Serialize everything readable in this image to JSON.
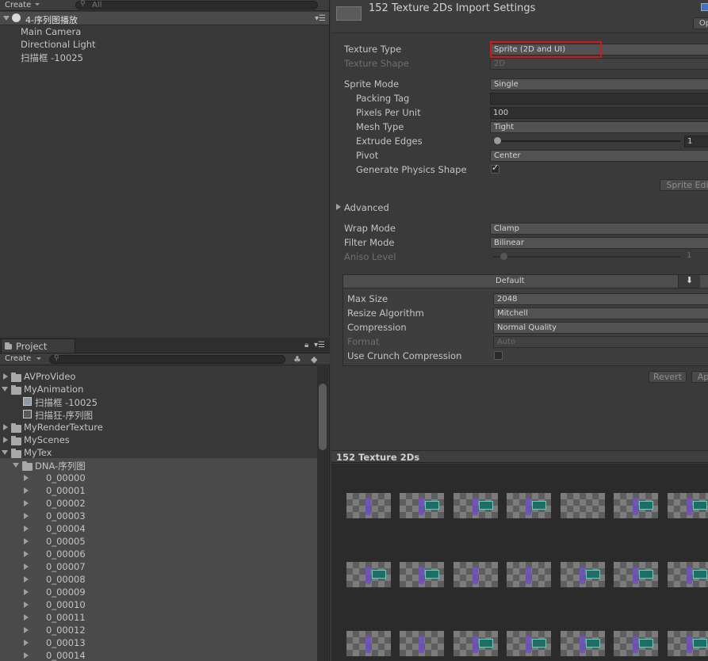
{
  "hierarchy": {
    "create_label": "Create",
    "search_placeholder": "All",
    "scene_name": "4-序列图播放",
    "items": [
      {
        "label": "Main Camera"
      },
      {
        "label": "Directional Light"
      },
      {
        "label": "扫描框 -10025"
      }
    ]
  },
  "project": {
    "tab_label": "Project",
    "create_label": "Create",
    "tree": [
      {
        "label": "AVProVideo"
      },
      {
        "label": "MyAnimation"
      },
      {
        "label": "扫描框 -10025"
      },
      {
        "label": "扫描狂-序列图"
      },
      {
        "label": "MyRenderTexture"
      },
      {
        "label": "MyScenes"
      },
      {
        "label": "MyTex"
      },
      {
        "label": "DNA-序列图"
      },
      {
        "label": "0_00000"
      },
      {
        "label": "0_00001"
      },
      {
        "label": "0_00002"
      },
      {
        "label": "0_00003"
      },
      {
        "label": "0_00004"
      },
      {
        "label": "0_00005"
      },
      {
        "label": "0_00006"
      },
      {
        "label": "0_00007"
      },
      {
        "label": "0_00008"
      },
      {
        "label": "0_00009"
      },
      {
        "label": "0_00010"
      },
      {
        "label": "0_00011"
      },
      {
        "label": "0_00012"
      },
      {
        "label": "0_00013"
      },
      {
        "label": "0_00014"
      }
    ]
  },
  "inspector": {
    "title": "152 Texture 2Ds Import Settings",
    "open_label": "Op",
    "texture_type": {
      "label": "Texture Type",
      "value": "Sprite (2D and UI)"
    },
    "texture_shape": {
      "label": "Texture Shape",
      "value": "2D"
    },
    "sprite_mode": {
      "label": "Sprite Mode",
      "value": "Single"
    },
    "packing_tag": {
      "label": "Packing Tag",
      "value": ""
    },
    "pixels_per_unit": {
      "label": "Pixels Per Unit",
      "value": "100"
    },
    "mesh_type": {
      "label": "Mesh Type",
      "value": "Tight"
    },
    "extrude_edges": {
      "label": "Extrude Edges",
      "value": "1",
      "level": 0.0
    },
    "pivot": {
      "label": "Pivot",
      "value": "Center"
    },
    "generate_physics_shape": {
      "label": "Generate Physics Shape",
      "checked": true
    },
    "sprite_editor_label": "Sprite Edi",
    "advanced_label": "Advanced",
    "wrap_mode": {
      "label": "Wrap Mode",
      "value": "Clamp"
    },
    "filter_mode": {
      "label": "Filter Mode",
      "value": "Bilinear"
    },
    "aniso_level": {
      "label": "Aniso Level",
      "value": "1",
      "level": 0.0
    },
    "platform_label": "Default",
    "max_size": {
      "label": "Max Size",
      "value": "2048"
    },
    "resize_algorithm": {
      "label": "Resize Algorithm",
      "value": "Mitchell"
    },
    "compression": {
      "label": "Compression",
      "value": "Normal Quality"
    },
    "format": {
      "label": "Format",
      "value": "Auto"
    },
    "use_crunch": {
      "label": "Use Crunch Compression",
      "checked": false
    },
    "revert_label": "Revert",
    "apply_label": "Ap"
  },
  "preview": {
    "title": "152 Texture 2Ds"
  },
  "colors": {
    "highlight_box": "#d01a1a",
    "selection": "#4a4a4a"
  }
}
